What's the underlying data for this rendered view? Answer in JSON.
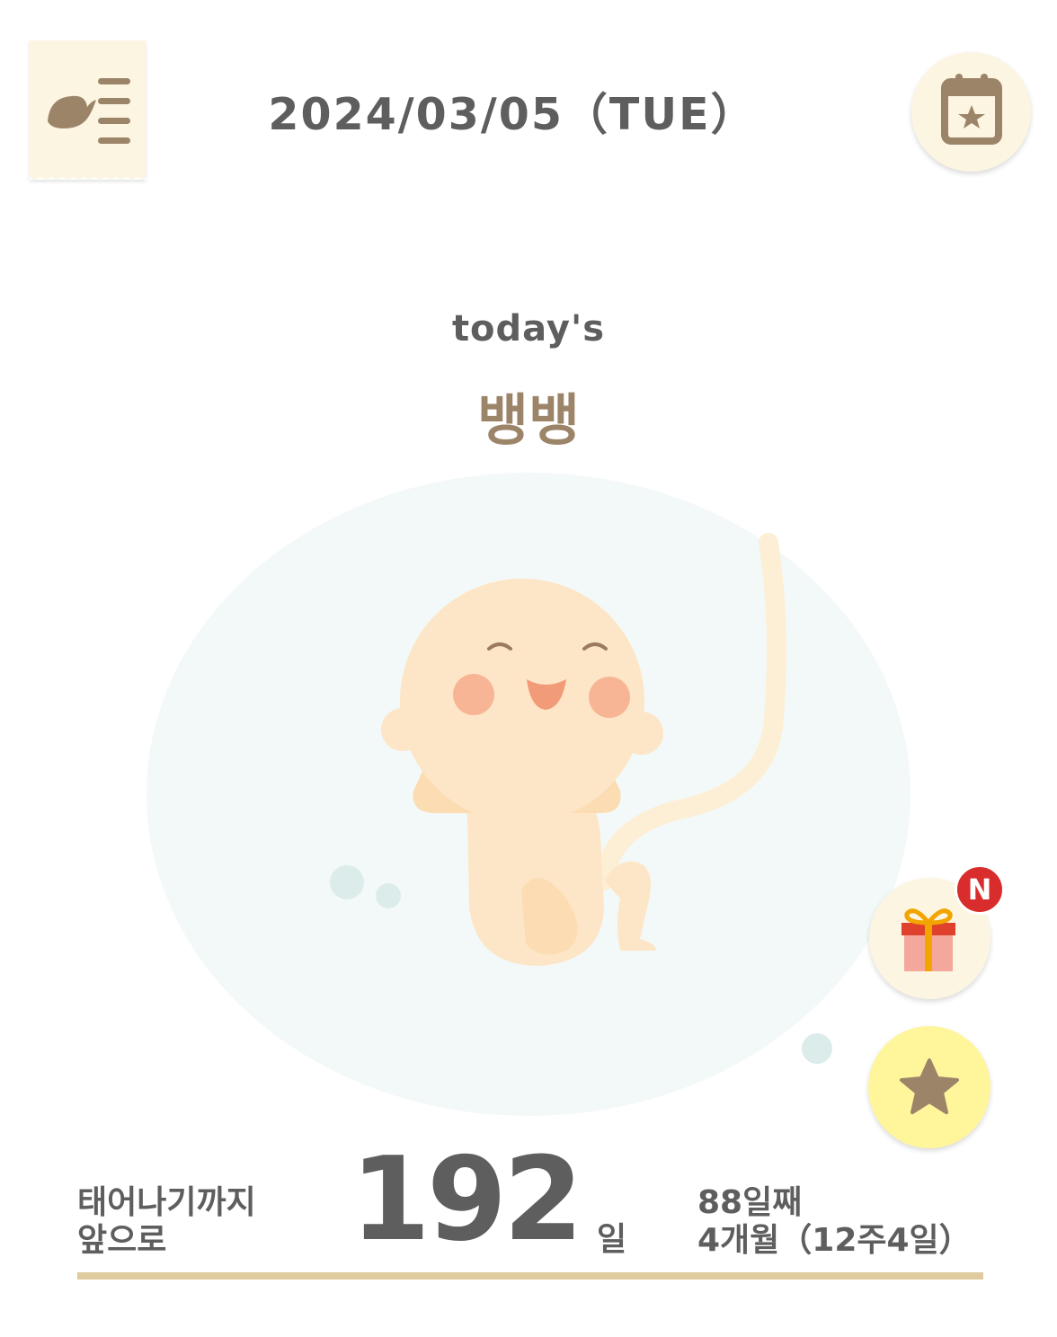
{
  "header": {
    "date": "2024/03/05",
    "weekday": "（TUE）",
    "menu_icon": "menu-icon",
    "calendar_icon": "calendar-star-icon"
  },
  "today": {
    "label": "today's",
    "word": "뱅뱅"
  },
  "actions": {
    "gift_icon": "gift-icon",
    "new_badge": "N",
    "star_icon": "star-icon"
  },
  "countdown": {
    "label_line1": "태어나기까지",
    "label_line2": "앞으로",
    "days": "192",
    "unit": "일",
    "day_count": "88일째",
    "month_week": "4개월（12주4일）",
    "progress_fraction": 1.0
  },
  "colors": {
    "text": "#5e5e5e",
    "accent_brown": "#9c8469",
    "badge_red": "#d92c2c",
    "star_button": "#fff59b",
    "cream": "#fcf5e2",
    "progress": "#dfcb9e"
  }
}
